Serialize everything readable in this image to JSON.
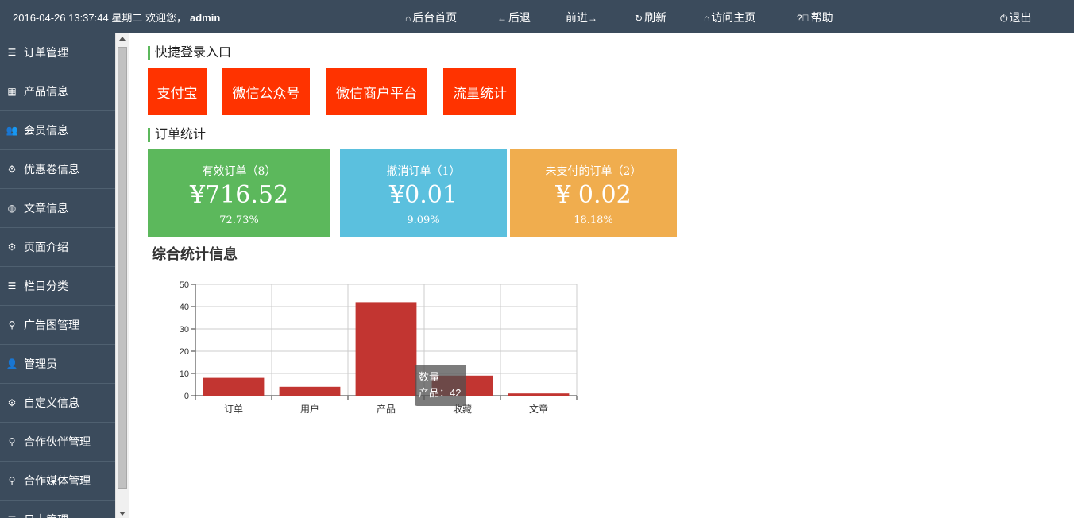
{
  "header": {
    "datetime": "2016-04-26 13:37:44",
    "weekday": "星期二",
    "welcome": "欢迎您，",
    "username": "admin",
    "nav": [
      {
        "label": "后台首页",
        "icon": "home-icon"
      },
      {
        "label": "后退",
        "icon": "arrow-left-icon"
      },
      {
        "label": "前进",
        "icon": "arrow-right-icon"
      },
      {
        "label": "刷新",
        "icon": "refresh-icon"
      },
      {
        "label": "访问主页",
        "icon": "home-icon"
      },
      {
        "label": "帮助",
        "icon": "help-icon"
      }
    ],
    "logout": {
      "label": "退出",
      "icon": "power-icon"
    }
  },
  "sidebar": {
    "items": [
      {
        "label": "订单管理",
        "icon": "list-icon"
      },
      {
        "label": "产品信息",
        "icon": "grid-icon"
      },
      {
        "label": "会员信息",
        "icon": "users-icon"
      },
      {
        "label": "优惠卷信息",
        "icon": "gear-icon"
      },
      {
        "label": "文章信息",
        "icon": "globe-icon"
      },
      {
        "label": "页面介绍",
        "icon": "gear-icon"
      },
      {
        "label": "栏目分类",
        "icon": "list-icon"
      },
      {
        "label": "广告图管理",
        "icon": "sitemap-icon"
      },
      {
        "label": "管理员",
        "icon": "user-icon"
      },
      {
        "label": "自定义信息",
        "icon": "gear-icon"
      },
      {
        "label": "合作伙伴管理",
        "icon": "sitemap-icon"
      },
      {
        "label": "合作媒体管理",
        "icon": "sitemap-icon"
      },
      {
        "label": "日志管理",
        "icon": "list-icon"
      }
    ]
  },
  "quick_login": {
    "title": "快捷登录入口",
    "buttons": [
      "支付宝",
      "微信公众号",
      "微信商户平台",
      "流量统计"
    ],
    "color": "#ff3300"
  },
  "order_stats": {
    "title": "订单统计",
    "cards": [
      {
        "label": "有效订单（8）",
        "amount": "¥716.52",
        "percent": "72.73%",
        "color": "#5cb85c"
      },
      {
        "label": "撤消订单（1）",
        "amount": "¥0.01",
        "percent": "9.09%",
        "color": "#5bc0de"
      },
      {
        "label": "未支付的订单（2）",
        "amount": "¥ 0.02",
        "percent": "18.18%",
        "color": "#f0ad4e"
      }
    ]
  },
  "overview": {
    "title": "综合统计信息",
    "tooltip": {
      "series": "数量",
      "text": "产品：42"
    }
  },
  "chart_data": {
    "type": "bar",
    "categories": [
      "订单",
      "用户",
      "产品",
      "收藏",
      "文章"
    ],
    "series": [
      {
        "name": "数量",
        "values": [
          8,
          4,
          42,
          9,
          1
        ]
      }
    ],
    "yticks": [
      0,
      10,
      20,
      30,
      40,
      50
    ],
    "ylim": [
      0,
      50
    ],
    "bar_color": "#c23531",
    "grid": true
  }
}
